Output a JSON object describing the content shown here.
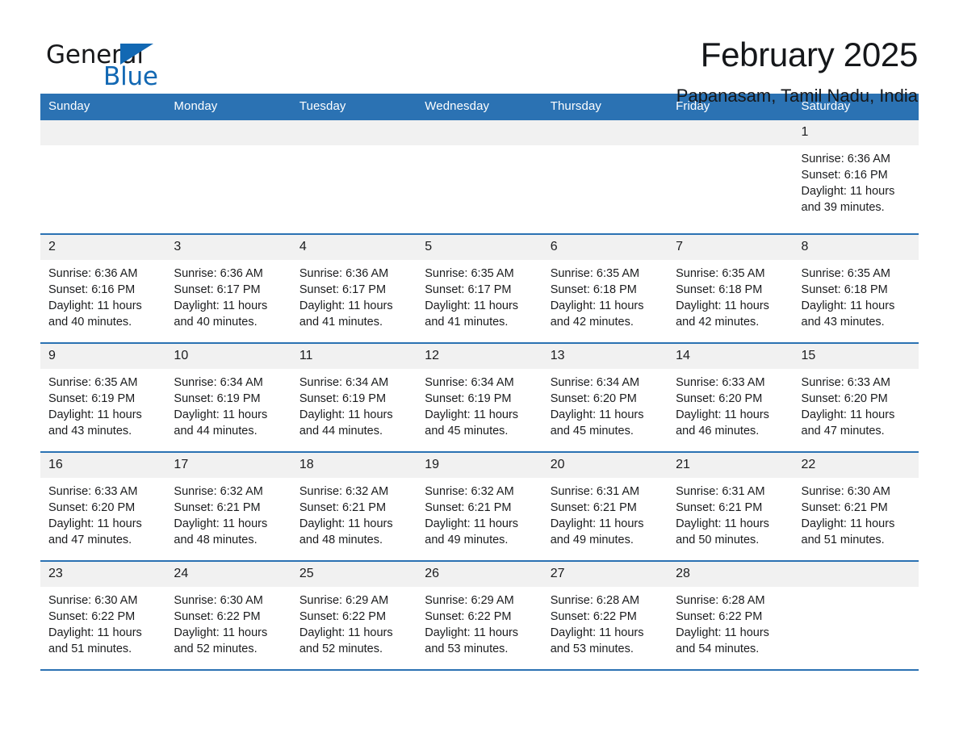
{
  "brand": {
    "name_top": "General",
    "name_bottom": "Blue",
    "wedge_color": "#1268b3",
    "text_color": "#17181a"
  },
  "header": {
    "title": "February 2025",
    "subtitle": "Papanasam, Tamil Nadu, India"
  },
  "theme": {
    "accent": "#2b72b3",
    "daynum_band": "#f1f1f1",
    "page_background": "#ffffff",
    "text": "#1b1c1e"
  },
  "calendar": {
    "weekday_headers": [
      "Sunday",
      "Monday",
      "Tuesday",
      "Wednesday",
      "Thursday",
      "Friday",
      "Saturday"
    ],
    "weeks": [
      [
        {
          "day": "",
          "blank": true
        },
        {
          "day": "",
          "blank": true
        },
        {
          "day": "",
          "blank": true
        },
        {
          "day": "",
          "blank": true
        },
        {
          "day": "",
          "blank": true
        },
        {
          "day": "",
          "blank": true
        },
        {
          "day": "1",
          "sunrise": "Sunrise: 6:36 AM",
          "sunset": "Sunset: 6:16 PM",
          "daylight": "Daylight: 11 hours and 39 minutes."
        }
      ],
      [
        {
          "day": "2",
          "sunrise": "Sunrise: 6:36 AM",
          "sunset": "Sunset: 6:16 PM",
          "daylight": "Daylight: 11 hours and 40 minutes."
        },
        {
          "day": "3",
          "sunrise": "Sunrise: 6:36 AM",
          "sunset": "Sunset: 6:17 PM",
          "daylight": "Daylight: 11 hours and 40 minutes."
        },
        {
          "day": "4",
          "sunrise": "Sunrise: 6:36 AM",
          "sunset": "Sunset: 6:17 PM",
          "daylight": "Daylight: 11 hours and 41 minutes."
        },
        {
          "day": "5",
          "sunrise": "Sunrise: 6:35 AM",
          "sunset": "Sunset: 6:17 PM",
          "daylight": "Daylight: 11 hours and 41 minutes."
        },
        {
          "day": "6",
          "sunrise": "Sunrise: 6:35 AM",
          "sunset": "Sunset: 6:18 PM",
          "daylight": "Daylight: 11 hours and 42 minutes."
        },
        {
          "day": "7",
          "sunrise": "Sunrise: 6:35 AM",
          "sunset": "Sunset: 6:18 PM",
          "daylight": "Daylight: 11 hours and 42 minutes."
        },
        {
          "day": "8",
          "sunrise": "Sunrise: 6:35 AM",
          "sunset": "Sunset: 6:18 PM",
          "daylight": "Daylight: 11 hours and 43 minutes."
        }
      ],
      [
        {
          "day": "9",
          "sunrise": "Sunrise: 6:35 AM",
          "sunset": "Sunset: 6:19 PM",
          "daylight": "Daylight: 11 hours and 43 minutes."
        },
        {
          "day": "10",
          "sunrise": "Sunrise: 6:34 AM",
          "sunset": "Sunset: 6:19 PM",
          "daylight": "Daylight: 11 hours and 44 minutes."
        },
        {
          "day": "11",
          "sunrise": "Sunrise: 6:34 AM",
          "sunset": "Sunset: 6:19 PM",
          "daylight": "Daylight: 11 hours and 44 minutes."
        },
        {
          "day": "12",
          "sunrise": "Sunrise: 6:34 AM",
          "sunset": "Sunset: 6:19 PM",
          "daylight": "Daylight: 11 hours and 45 minutes."
        },
        {
          "day": "13",
          "sunrise": "Sunrise: 6:34 AM",
          "sunset": "Sunset: 6:20 PM",
          "daylight": "Daylight: 11 hours and 45 minutes."
        },
        {
          "day": "14",
          "sunrise": "Sunrise: 6:33 AM",
          "sunset": "Sunset: 6:20 PM",
          "daylight": "Daylight: 11 hours and 46 minutes."
        },
        {
          "day": "15",
          "sunrise": "Sunrise: 6:33 AM",
          "sunset": "Sunset: 6:20 PM",
          "daylight": "Daylight: 11 hours and 47 minutes."
        }
      ],
      [
        {
          "day": "16",
          "sunrise": "Sunrise: 6:33 AM",
          "sunset": "Sunset: 6:20 PM",
          "daylight": "Daylight: 11 hours and 47 minutes."
        },
        {
          "day": "17",
          "sunrise": "Sunrise: 6:32 AM",
          "sunset": "Sunset: 6:21 PM",
          "daylight": "Daylight: 11 hours and 48 minutes."
        },
        {
          "day": "18",
          "sunrise": "Sunrise: 6:32 AM",
          "sunset": "Sunset: 6:21 PM",
          "daylight": "Daylight: 11 hours and 48 minutes."
        },
        {
          "day": "19",
          "sunrise": "Sunrise: 6:32 AM",
          "sunset": "Sunset: 6:21 PM",
          "daylight": "Daylight: 11 hours and 49 minutes."
        },
        {
          "day": "20",
          "sunrise": "Sunrise: 6:31 AM",
          "sunset": "Sunset: 6:21 PM",
          "daylight": "Daylight: 11 hours and 49 minutes."
        },
        {
          "day": "21",
          "sunrise": "Sunrise: 6:31 AM",
          "sunset": "Sunset: 6:21 PM",
          "daylight": "Daylight: 11 hours and 50 minutes."
        },
        {
          "day": "22",
          "sunrise": "Sunrise: 6:30 AM",
          "sunset": "Sunset: 6:21 PM",
          "daylight": "Daylight: 11 hours and 51 minutes."
        }
      ],
      [
        {
          "day": "23",
          "sunrise": "Sunrise: 6:30 AM",
          "sunset": "Sunset: 6:22 PM",
          "daylight": "Daylight: 11 hours and 51 minutes."
        },
        {
          "day": "24",
          "sunrise": "Sunrise: 6:30 AM",
          "sunset": "Sunset: 6:22 PM",
          "daylight": "Daylight: 11 hours and 52 minutes."
        },
        {
          "day": "25",
          "sunrise": "Sunrise: 6:29 AM",
          "sunset": "Sunset: 6:22 PM",
          "daylight": "Daylight: 11 hours and 52 minutes."
        },
        {
          "day": "26",
          "sunrise": "Sunrise: 6:29 AM",
          "sunset": "Sunset: 6:22 PM",
          "daylight": "Daylight: 11 hours and 53 minutes."
        },
        {
          "day": "27",
          "sunrise": "Sunrise: 6:28 AM",
          "sunset": "Sunset: 6:22 PM",
          "daylight": "Daylight: 11 hours and 53 minutes."
        },
        {
          "day": "28",
          "sunrise": "Sunrise: 6:28 AM",
          "sunset": "Sunset: 6:22 PM",
          "daylight": "Daylight: 11 hours and 54 minutes."
        },
        {
          "day": "",
          "blank": true
        }
      ]
    ]
  }
}
